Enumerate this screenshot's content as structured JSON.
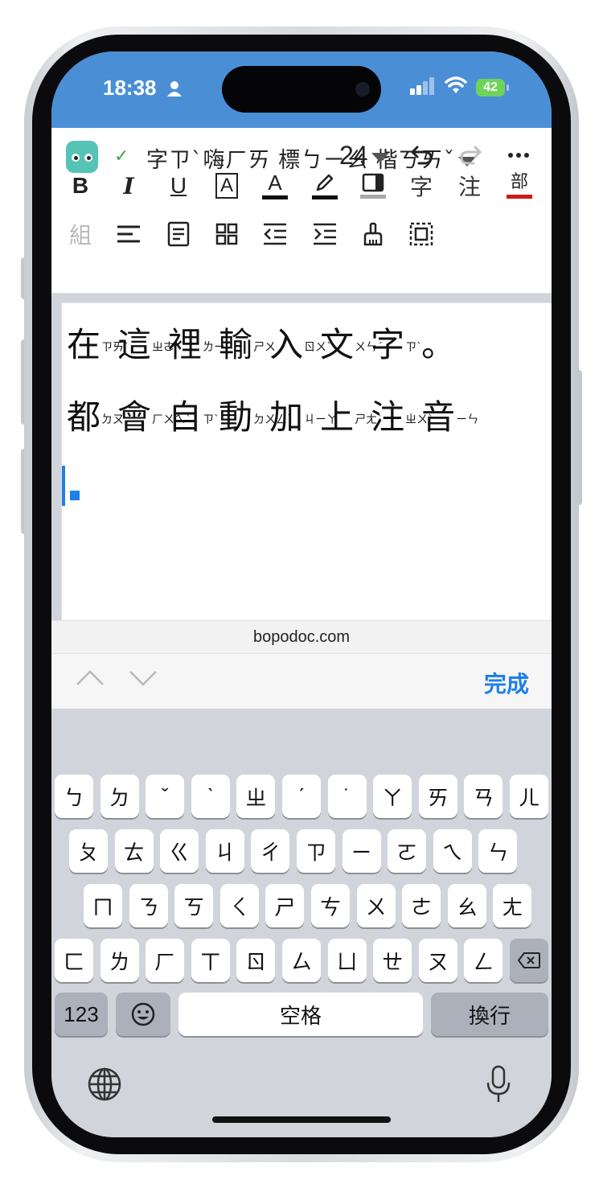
{
  "status": {
    "time": "18:38",
    "battery": "42"
  },
  "toolbar": {
    "font_menu": "字ㄗˋ嗨ㄏㄞ 標ㄅㄧㄠ 楷ㄎㄞˇ",
    "font_size": "24"
  },
  "format_row1": [
    "B",
    "I",
    "U",
    "A",
    "A",
    "",
    "",
    "字",
    "注",
    "部"
  ],
  "format_row2": [
    "組"
  ],
  "editor": {
    "line1": [
      {
        "ch": "在",
        "zy": "ㄗㄞˋ"
      },
      {
        "ch": "這",
        "zy": "ㄓㄜˋ"
      },
      {
        "ch": "裡",
        "zy": "ㄌㄧˇ"
      },
      {
        "ch": "輸",
        "zy": "ㄕㄨ"
      },
      {
        "ch": "入",
        "zy": "ㄖㄨˋ"
      },
      {
        "ch": "文",
        "zy": "ㄨㄣˊ"
      },
      {
        "ch": "字",
        "zy": "ㄗˋ"
      }
    ],
    "line1_end": "。",
    "line2": [
      {
        "ch": "都",
        "zy": "ㄉㄡ"
      },
      {
        "ch": "會",
        "zy": "ㄏㄨㄟˋ"
      },
      {
        "ch": "自",
        "zy": "ㄗˋ"
      },
      {
        "ch": "動",
        "zy": "ㄉㄨㄥˋ"
      },
      {
        "ch": "加",
        "zy": "ㄐㄧㄚ"
      },
      {
        "ch": "上",
        "zy": "ㄕㄤˋ"
      },
      {
        "ch": "注",
        "zy": "ㄓㄨˋ"
      },
      {
        "ch": "音",
        "zy": "ㄧㄣ"
      }
    ]
  },
  "browser": {
    "url": "bopodoc.com"
  },
  "accessory": {
    "done": "完成"
  },
  "keyboard": {
    "row1": [
      "ㄅ",
      "ㄉ",
      "ˇ",
      "ˋ",
      "ㄓ",
      "ˊ",
      "˙",
      "ㄚ",
      "ㄞ",
      "ㄢ",
      "ㄦ"
    ],
    "row2": [
      "ㄆ",
      "ㄊ",
      "ㄍ",
      "ㄐ",
      "ㄔ",
      "ㄗ",
      "ㄧ",
      "ㄛ",
      "ㄟ",
      "ㄣ"
    ],
    "row3": [
      "ㄇ",
      "ㄋ",
      "ㄎ",
      "ㄑ",
      "ㄕ",
      "ㄘ",
      "ㄨ",
      "ㄜ",
      "ㄠ",
      "ㄤ"
    ],
    "row4": [
      "ㄈ",
      "ㄌ",
      "ㄏ",
      "ㄒ",
      "ㄖ",
      "ㄙ",
      "ㄩ",
      "ㄝ",
      "ㄡ",
      "ㄥ"
    ],
    "numbers": "123",
    "space": "空格",
    "return": "換行"
  },
  "colors": {
    "accent": "#4a8fd6",
    "cursor": "#1e7fe8",
    "bushou_underline": "#cc1b1b"
  }
}
